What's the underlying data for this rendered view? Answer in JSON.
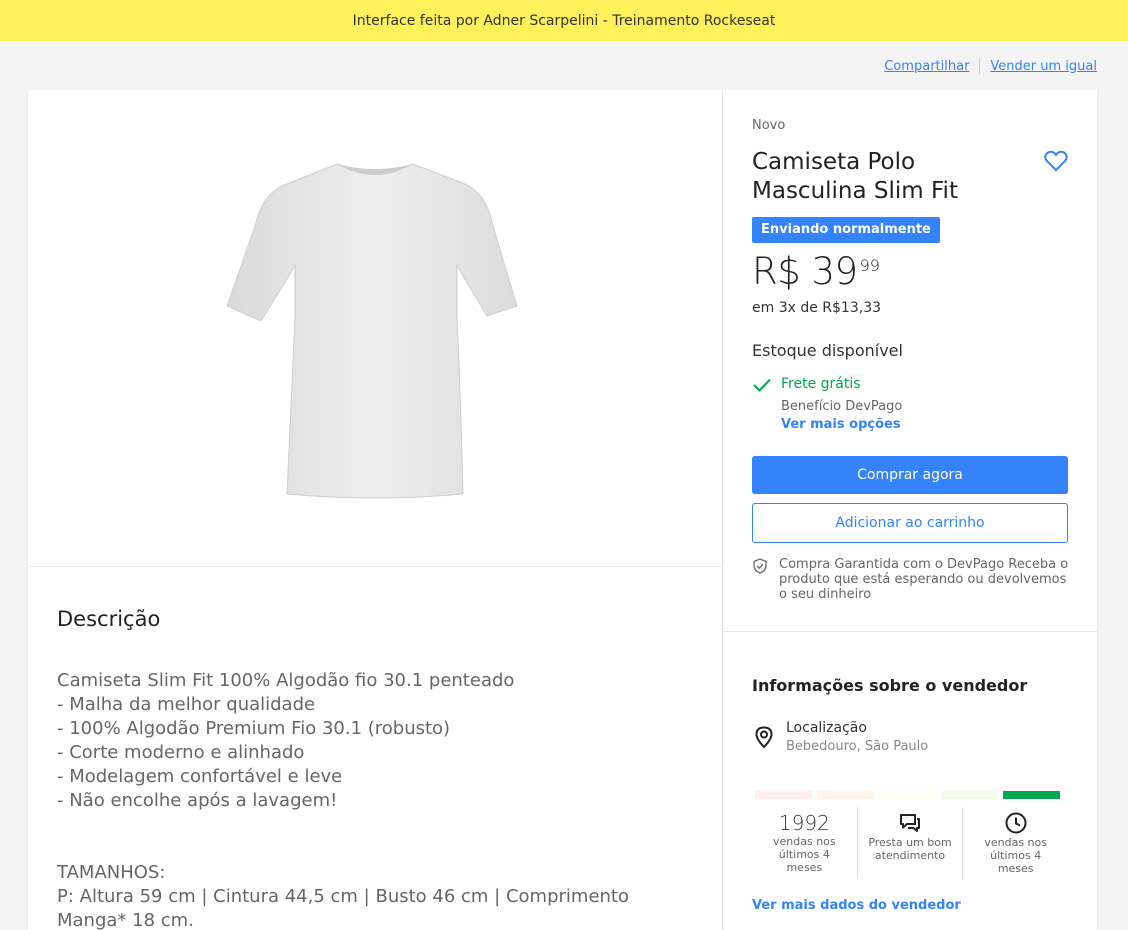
{
  "topbar": {
    "text": "Interface feita por Adner Scarpelini - Treinamento Rockeseat"
  },
  "links": {
    "share": "Compartilhar",
    "sell": "Vender um igual"
  },
  "product": {
    "condition": "Novo",
    "title": "Camiseta Polo Masculina Slim Fit",
    "badge": "Enviando normalmente",
    "price_main": "R$ 39",
    "price_cents": "99",
    "installments": "em 3x de R$13,33",
    "stock": "Estoque disponível",
    "shipping": "Frete grátis",
    "benefit": "Benefício DevPago",
    "more_options": "Ver mais opções",
    "buy_button": "Comprar agora",
    "cart_button": "Adicionar ao carrinho",
    "guarantee": "Compra Garantida com o DevPago Receba o produto que está esperando ou devolvemos o seu dinheiro"
  },
  "description": {
    "heading": "Descrição",
    "lines": [
      "Camiseta Slim Fit 100% Algodão fio 30.1 penteado",
      "- Malha da melhor qualidade",
      "- 100% Algodão Premium Fio 30.1 (robusto)",
      "- Corte moderno e alinhado",
      "- Modelagem confortável e leve",
      "- Não encolhe após a lavagem!"
    ],
    "sizes_heading": "TAMANHOS:",
    "sizes_lines": [
      "P: Altura 59 cm | Cintura 44,5 cm | Busto 46 cm | Comprimento",
      "Manga* 18 cm."
    ]
  },
  "seller": {
    "heading": "Informações sobre o vendedor",
    "location_label": "Localização",
    "location_value": "Bebedouro, São Paulo",
    "reputation_colors": [
      "#fff0ef",
      "#fff5e8",
      "#fffff0",
      "#f1fde7",
      "#00a650"
    ],
    "stats": [
      {
        "value": "1992",
        "caption": "vendas nos últimos 4 meses"
      },
      {
        "icon": "chat-icon",
        "caption": "Presta um bom atendimento"
      },
      {
        "icon": "clock-icon",
        "caption": "vendas nos últimos 4 meses"
      }
    ],
    "more_link": "Ver mais dados do vendedor"
  },
  "colors": {
    "accent": "#3483fa",
    "success": "#00a650",
    "topbar": "#fff159"
  }
}
